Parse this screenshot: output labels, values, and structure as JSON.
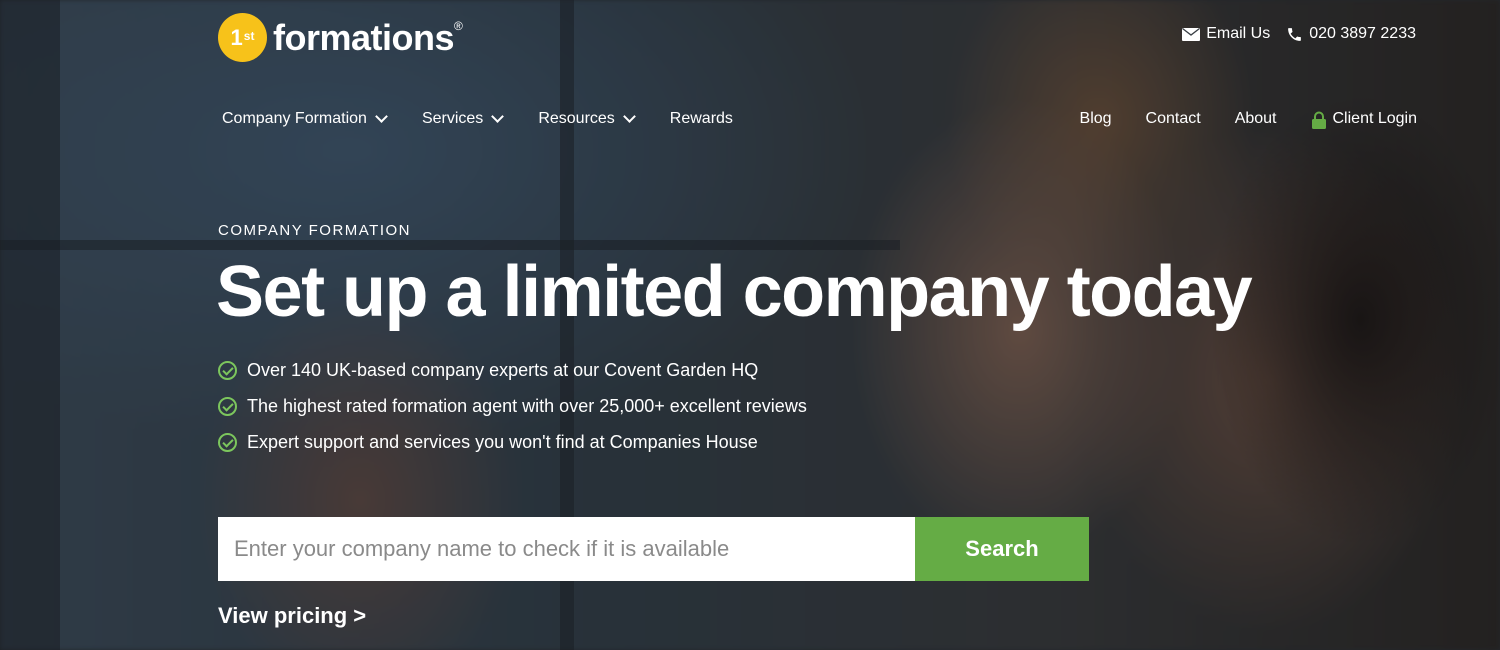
{
  "brand": {
    "badge": "1",
    "badge_suffix": "st",
    "name": "formations",
    "registered": "®",
    "color": "#f7c21a"
  },
  "contact": {
    "email_label": "Email Us",
    "email_icon": "envelope-icon",
    "phone": "020 3897 2233",
    "phone_icon": "phone-icon"
  },
  "nav": {
    "left": [
      {
        "label": "Company Formation",
        "dropdown": true
      },
      {
        "label": "Services",
        "dropdown": true
      },
      {
        "label": "Resources",
        "dropdown": true
      },
      {
        "label": "Rewards",
        "dropdown": false
      }
    ],
    "right": [
      {
        "label": "Blog"
      },
      {
        "label": "Contact"
      },
      {
        "label": "About"
      }
    ],
    "login": {
      "label": "Client Login",
      "icon": "lock-icon",
      "icon_color": "#65ac45"
    }
  },
  "hero": {
    "eyebrow": "COMPANY FORMATION",
    "title": "Set up a limited company today",
    "bullets": [
      "Over 140 UK-based company experts at our Covent Garden HQ",
      "The highest rated formation agent with over 25,000+ excellent reviews",
      "Expert support and services you won't find at Companies House"
    ],
    "bullet_icon_color": "#7cc65d"
  },
  "search": {
    "placeholder": "Enter your company name to check if it is available",
    "value": "",
    "button_label": "Search",
    "button_color": "#65ac45"
  },
  "pricing_link": "View pricing >"
}
